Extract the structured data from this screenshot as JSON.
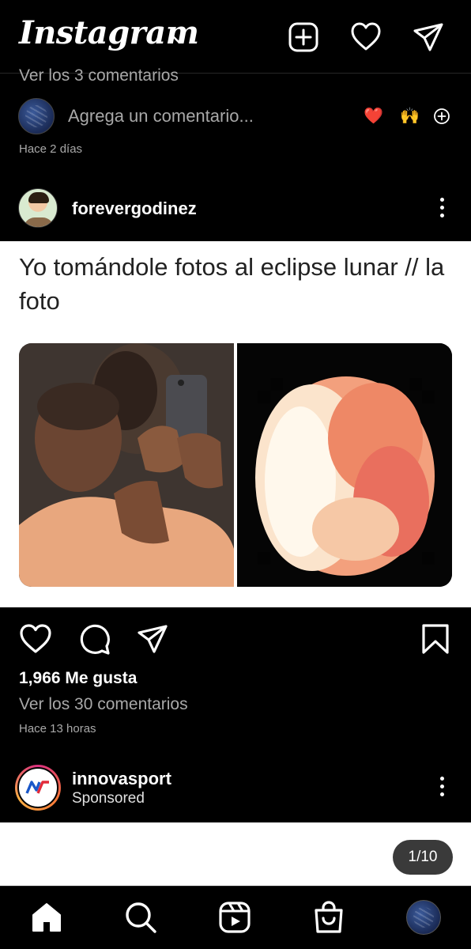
{
  "app": {
    "name": "Instagram"
  },
  "header": {
    "logo_text": "Instagram",
    "icons": [
      "new-post-icon",
      "heart-icon",
      "direct-message-icon"
    ]
  },
  "previous_post": {
    "view_comments": "Ver los 3 comentarios",
    "add_comment_placeholder": "Agrega un comentario...",
    "quick_emojis": [
      "❤️",
      "🙌"
    ],
    "time": "Hace 2 días"
  },
  "post": {
    "username": "forevergodinez",
    "caption": "Yo tomándole fotos al eclipse lunar // la foto",
    "likes": "1,966 Me gusta",
    "view_comments": "Ver los 30 comentarios",
    "time": "Hace 13 horas"
  },
  "sponsored_post": {
    "username": "innovasport",
    "label": "Sponsored",
    "carousel_counter": "1/10",
    "logo_text": "NV"
  },
  "bottom_nav": {
    "items": [
      "home-icon",
      "search-icon",
      "reels-icon",
      "shop-icon",
      "profile-avatar"
    ]
  },
  "colors": {
    "background": "#000000",
    "secondary_text": "#a8a8a8",
    "like_red": "#ed4956",
    "brand_gradient": [
      "#d92e7f",
      "#f77737",
      "#fcaf45"
    ]
  }
}
